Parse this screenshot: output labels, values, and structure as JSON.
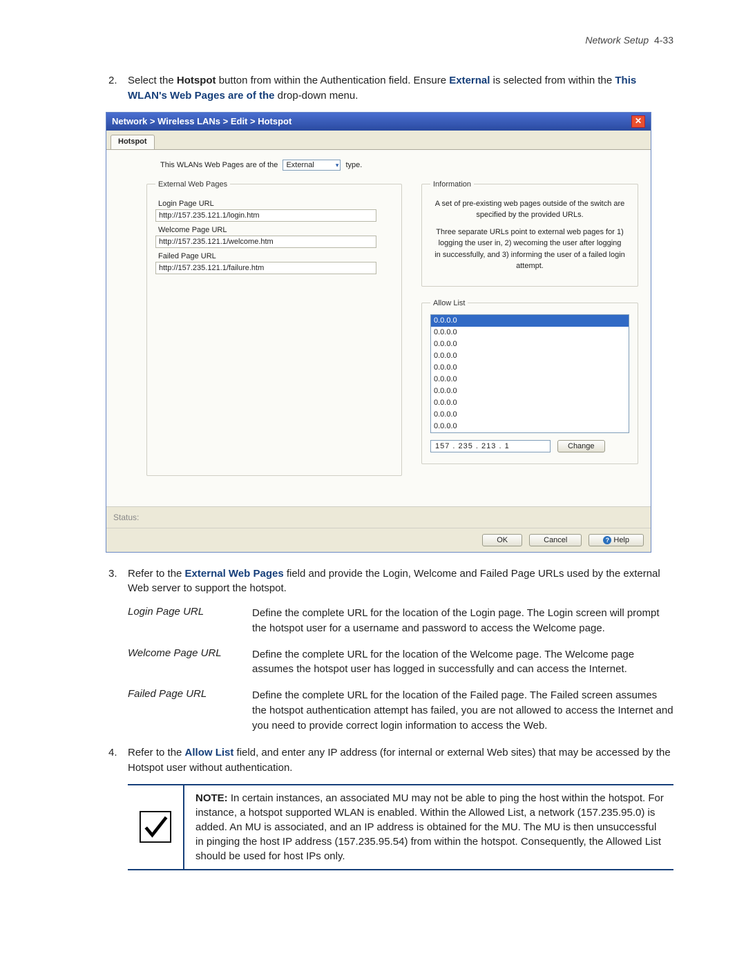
{
  "header": {
    "section": "Network Setup",
    "page": "4-33"
  },
  "step2": {
    "prefix": "2.",
    "t1": "Select the ",
    "hotspot": "Hotspot",
    "t2": " button from within the Authentication field. Ensure ",
    "external": "External",
    "t3": " is selected from within the ",
    "ddlabel": "This WLAN's Web Pages are of the",
    "t4": " drop-down menu."
  },
  "dialog": {
    "breadcrumb": "Network > Wireless LANs > Edit > Hotspot",
    "tab": "Hotspot",
    "topline_pre": "This WLANs Web Pages are of the",
    "topline_sel": "External",
    "topline_post": "type.",
    "ext_legend": "External Web Pages",
    "login_lbl": "Login Page URL",
    "login_val": "http://157.235.121.1/login.htm",
    "welcome_lbl": "Welcome Page URL",
    "welcome_val": "http://157.235.121.1/welcome.htm",
    "failed_lbl": "Failed Page URL",
    "failed_val": "http://157.235.121.1/failure.htm",
    "info_legend": "Information",
    "info1": "A set of pre-existing web pages outside of the switch are specified by the provided URLs.",
    "info2": "Three separate URLs point to external web pages for 1) logging the user in, 2) wecoming the user after logging in successfully, and 3) informing the user of a failed login attempt.",
    "allow_legend": "Allow List",
    "allow_items": [
      "0.0.0.0",
      "0.0.0.0",
      "0.0.0.0",
      "0.0.0.0",
      "0.0.0.0",
      "0.0.0.0",
      "0.0.0.0",
      "0.0.0.0",
      "0.0.0.0",
      "0.0.0.0"
    ],
    "ip_value": "157 . 235 . 213 .   1",
    "change_btn": "Change",
    "status_label": "Status:",
    "ok": "OK",
    "cancel": "Cancel",
    "help": "Help"
  },
  "step3": {
    "prefix": "3.",
    "t1": "Refer to the ",
    "ext": "External Web Pages",
    "t2": " field and provide the Login, Welcome and Failed Page URLs used by the external Web server to support the hotspot."
  },
  "defs": {
    "login_t": "Login Page URL",
    "login_d": "Define the complete URL for the location of the Login page. The Login screen will prompt the hotspot user for a username and password to access the Welcome page.",
    "welcome_t": "Welcome Page URL",
    "welcome_d": "Define the complete URL for the location of the Welcome page. The Welcome page assumes the hotspot user has logged in successfully and can access the Internet.",
    "failed_t": "Failed Page URL",
    "failed_d": "Define the complete URL for the location of the Failed page. The Failed screen assumes the hotspot authentication attempt has failed, you are not allowed to access the Internet and you need to provide correct login information to access the Web."
  },
  "step4": {
    "prefix": "4.",
    "t1": "Refer to the ",
    "allow": "Allow List",
    "t2": " field, and enter any IP address (for internal or external Web sites) that may be accessed by the Hotspot user without authentication."
  },
  "note": {
    "bold": "NOTE:",
    "text": " In certain instances, an associated MU may not be able to ping the host within the hotspot. For instance, a hotspot supported WLAN is enabled. Within the Allowed List, a network (157.235.95.0) is added. An MU is associated, and an IP address is obtained for the MU. The MU is then unsuccessful in pinging the host IP address (157.235.95.54) from within the hotspot. Consequently, the Allowed List should be used for host IPs only."
  }
}
